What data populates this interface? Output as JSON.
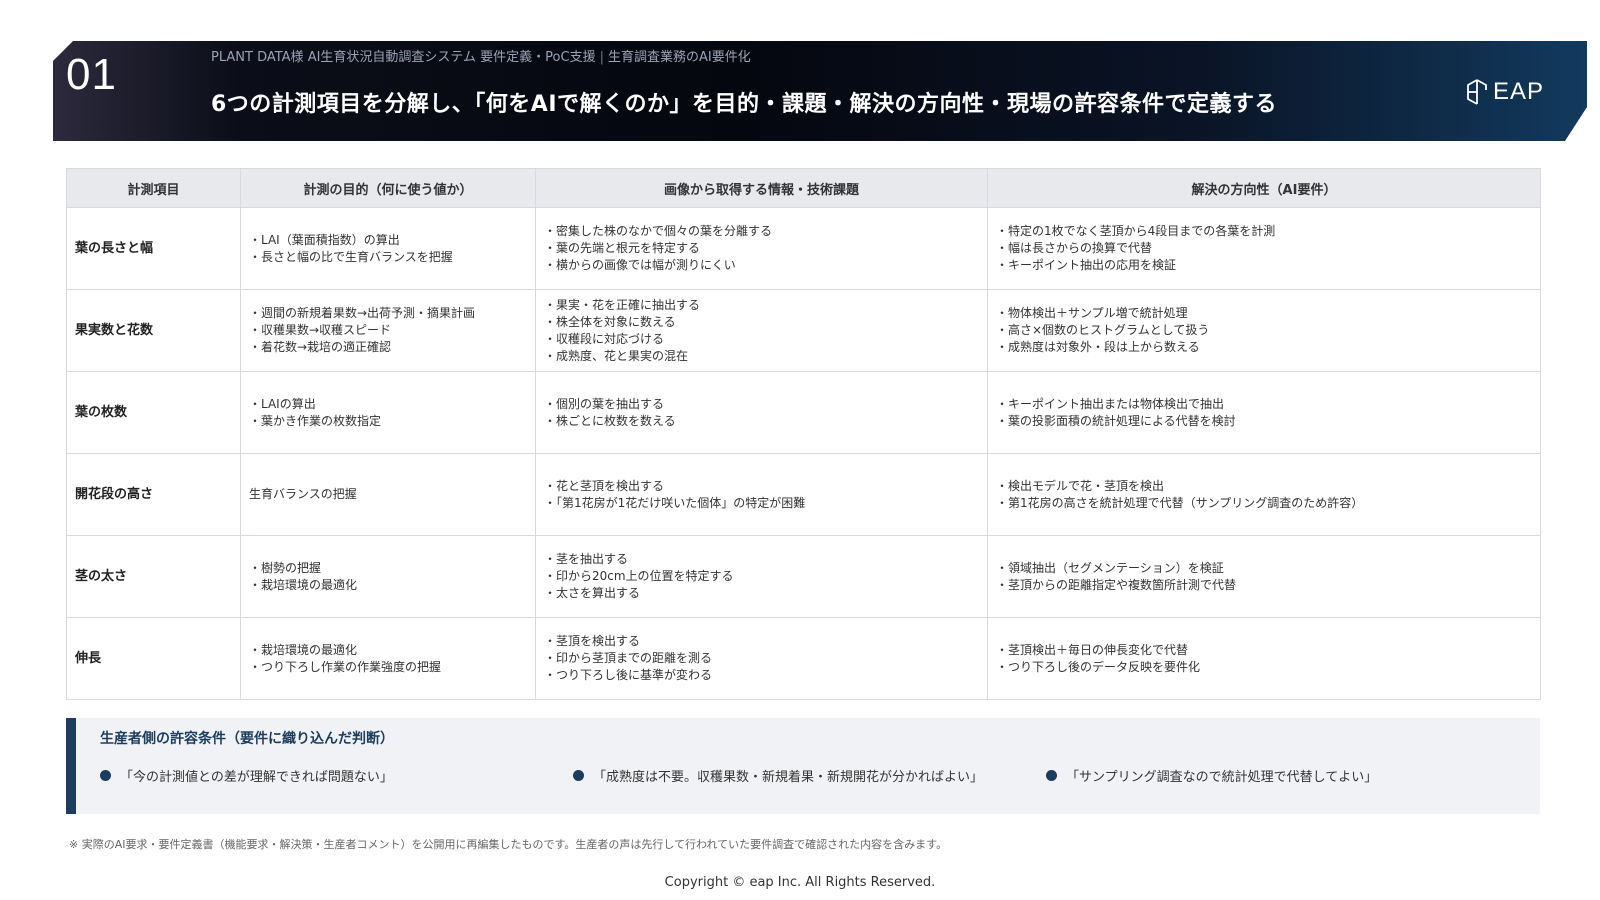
{
  "header": {
    "slide_number": "01",
    "breadcrumb_project": "PLANT DATA様 AI生育状況自動調査システム 要件定義・PoC支援",
    "breadcrumb_separator": "|",
    "breadcrumb_section": "生育調査業務のAI要件化",
    "title": "6つの計測項目を分解し、「何をAIで解くのか」を目的・課題・解決の方向性・現場の許容条件で定義する",
    "logo_text": "EAP"
  },
  "table": {
    "headers": [
      "計測項目",
      "計測の目的（何に使う値か）",
      "画像から取得する情報・技術課題",
      "解決の方向性（AI要件）"
    ],
    "rows": [
      {
        "item": "葉の長さと幅",
        "purpose": [
          "・LAI（葉面積指数）の算出",
          "・長さと幅の比で生育バランスを把握"
        ],
        "challenges": [
          "・密集した株のなかで個々の葉を分離する",
          "・葉の先端と根元を特定する",
          "・横からの画像では幅が測りにくい"
        ],
        "solution": [
          "・特定の1枚でなく茎頂から4段目までの各葉を計測",
          "・幅は長さからの換算で代替",
          "・キーポイント抽出の応用を検証"
        ]
      },
      {
        "item": "果実数と花数",
        "purpose": [
          "・週間の新規着果数→出荷予測・摘果計画",
          "・収穫果数→収穫スピード",
          "・着花数→栽培の適正確認"
        ],
        "challenges": [
          "・果実・花を正確に抽出する",
          "・株全体を対象に数える",
          "・収穫段に対応づける",
          "・成熟度、花と果実の混在"
        ],
        "solution": [
          "・物体検出＋サンプル増で統計処理",
          "・高さ×個数のヒストグラムとして扱う",
          "・成熟度は対象外・段は上から数える"
        ]
      },
      {
        "item": "葉の枚数",
        "purpose": [
          "・LAIの算出",
          "・葉かき作業の枚数指定"
        ],
        "challenges": [
          "・個別の葉を抽出する",
          "・株ごとに枚数を数える"
        ],
        "solution": [
          "・キーポイント抽出または物体検出で抽出",
          "・葉の投影面積の統計処理による代替を検討"
        ]
      },
      {
        "item": "開花段の高さ",
        "purpose": [
          "生育バランスの把握"
        ],
        "challenges": [
          "・花と茎頂を検出する",
          "・「第1花房が1花だけ咲いた個体」の特定が困難"
        ],
        "solution": [
          "・検出モデルで花・茎頂を検出",
          "・第1花房の高さを統計処理で代替（サンプリング調査のため許容）"
        ]
      },
      {
        "item": "茎の太さ",
        "purpose": [
          "・樹勢の把握",
          "・栽培環境の最適化"
        ],
        "challenges": [
          "・茎を抽出する",
          "・印から20cm上の位置を特定する",
          "・太さを算出する"
        ],
        "solution": [
          "・領域抽出（セグメンテーション）を検証",
          "・茎頂からの距離指定や複数箇所計測で代替"
        ]
      },
      {
        "item": "伸長",
        "purpose": [
          "・栽培環境の最適化",
          "・つり下ろし作業の作業強度の把握"
        ],
        "challenges": [
          "・茎頂を検出する",
          "・印から茎頂までの距離を測る",
          "・つり下ろし後に基準が変わる"
        ],
        "solution": [
          "・茎頂検出＋毎日の伸長変化で代替",
          "・つり下ろし後のデータ反映を要件化"
        ]
      }
    ]
  },
  "conditions": {
    "title": "生産者側の許容条件（要件に織り込んだ判断）",
    "items": [
      "「今の計測値との差が理解できれば問題ない」",
      "「成熟度は不要。収穫果数・新規着果・新規開花が分かればよい」",
      "「サンプリング調査なので統計処理で代替してよい」"
    ]
  },
  "footnote": "※ 実際のAI要求・要件定義書（機能要求・解決策・生産者コメント）を公開用に再編集したものです。生産者の声は先行して行われていた要件調査で確認された内容を含みます。",
  "copyright": "Copyright © eap Inc. All Rights Reserved.",
  "colors": {
    "accent": "#1c3d5e",
    "header_bg": "#05070f",
    "table_header_bg": "#e8e9ec",
    "panel_bg": "#f0f2f5"
  }
}
